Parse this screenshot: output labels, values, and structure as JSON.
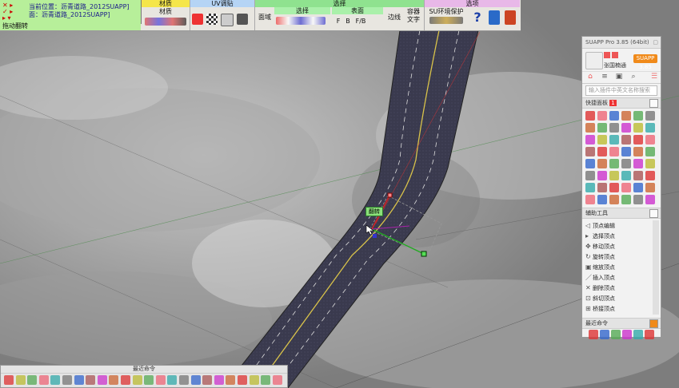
{
  "toolbar": {
    "info": {
      "current_label": "当前位置：",
      "current_value": "沥青道路_2012SUAPP]",
      "face_label": "面：",
      "face_value": "沥青道路_2012SUAPP]",
      "status": "拖动翻转"
    },
    "groups": {
      "material_a": "材质",
      "material_b": "材质",
      "uv": "UV调贴",
      "select": "选择",
      "options": "选项"
    },
    "buttons": {
      "face_domain": "面域",
      "select_sub": "选择",
      "surface": "表面",
      "edge": "边线",
      "container_text_1": "容器",
      "container_text_2": "文字",
      "su_env": "SU环境保护",
      "help": "?",
      "surface_opts": [
        "F",
        "B",
        "F/B"
      ]
    }
  },
  "viewport": {
    "tooltip": "翻转",
    "road_color": "#3a3a4e",
    "line_color": "#d9c34a"
  },
  "panel": {
    "title": "SUAPP Pro 3.85 (64bit)",
    "username": "张国楠通",
    "version_badge": "SUAPP 3.85",
    "search_placeholder": "输入插件中英文名称搜索",
    "quick_panel_label": "快捷面板",
    "quick_panel_num": "1",
    "aux_tools_label": "辅助工具",
    "aux_items": [
      {
        "icon": "◁",
        "label": "顶点编辑"
      },
      {
        "icon": "▸",
        "label": "选择顶点"
      },
      {
        "icon": "✥",
        "label": "移动顶点"
      },
      {
        "icon": "↻",
        "label": "旋转顶点"
      },
      {
        "icon": "▣",
        "label": "缩放顶点"
      },
      {
        "icon": "／",
        "label": "插入顶点"
      },
      {
        "icon": "✕",
        "label": "删除顶点"
      },
      {
        "icon": "⊡",
        "label": "斜切顶点"
      },
      {
        "icon": "⊞",
        "label": "桥接顶点"
      }
    ],
    "recent_label": "最近命令"
  },
  "bottom": {
    "title": "最近命令"
  }
}
